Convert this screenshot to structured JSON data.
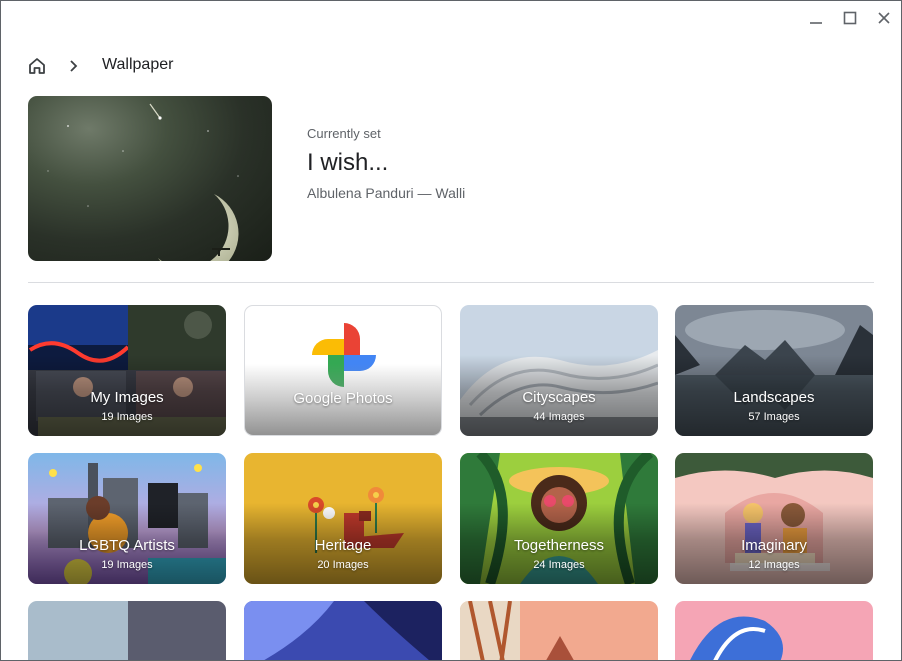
{
  "window": {
    "controls": [
      {
        "name": "minimize-button",
        "icon": "minimize-icon"
      },
      {
        "name": "maximize-button",
        "icon": "maximize-icon"
      },
      {
        "name": "close-button",
        "icon": "close-icon"
      }
    ]
  },
  "breadcrumb": {
    "home_icon": "home-icon",
    "separator_icon": "chevron-right-icon",
    "current": "Wallpaper"
  },
  "current": {
    "label": "Currently set",
    "title": "I wish...",
    "author": "Albulena Panduri — Walli"
  },
  "collections": [
    {
      "name": "My Images",
      "count": "19 Images"
    },
    {
      "name": "Google Photos",
      "count": ""
    },
    {
      "name": "Cityscapes",
      "count": "44 Images"
    },
    {
      "name": "Landscapes",
      "count": "57 Images"
    },
    {
      "name": "LGBTQ Artists",
      "count": "19 Images"
    },
    {
      "name": "Heritage",
      "count": "20 Images"
    },
    {
      "name": "Togetherness",
      "count": "24 Images"
    },
    {
      "name": "Imaginary",
      "count": "12 Images"
    }
  ],
  "colors": {
    "text_primary": "#202124",
    "text_secondary": "#5f6368",
    "divider": "#dadce0"
  }
}
